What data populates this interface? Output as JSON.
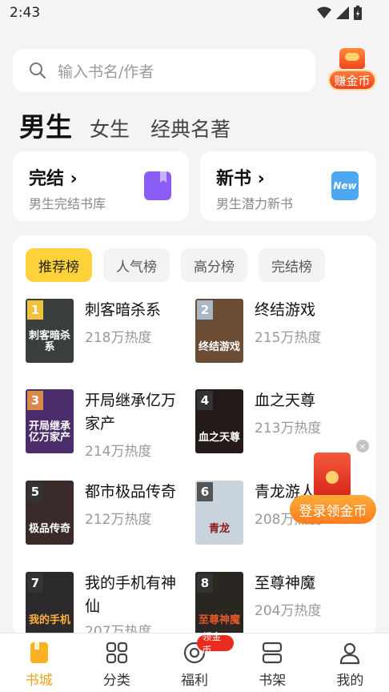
{
  "status": {
    "time": "2:43"
  },
  "search": {
    "placeholder": "输入书名/作者"
  },
  "coin_button": {
    "label": "赚金币"
  },
  "category_tabs": [
    "男生",
    "女生",
    "经典名著"
  ],
  "entries": [
    {
      "title": "完结",
      "subtitle": "男生完结书库",
      "icon": "bookmark-icon",
      "color": "#8b5cf6"
    },
    {
      "title": "新书",
      "subtitle": "男生潜力新书",
      "icon": "new-badge-icon",
      "icon_text": "New",
      "color": "#4da8f0"
    }
  ],
  "rank_tabs": [
    "推荐榜",
    "人气榜",
    "高分榜",
    "完结榜"
  ],
  "books": [
    {
      "rank": "1",
      "title": "刺客暗杀系",
      "heat": "218万热度",
      "cover_text": "刺客暗杀系",
      "cover_color": "#3a3f3c"
    },
    {
      "rank": "2",
      "title": "终结游戏",
      "heat": "215万热度",
      "cover_text": "终结游戏",
      "cover_color": "#6b4d36"
    },
    {
      "rank": "3",
      "title": "开局继承亿万家产",
      "heat": "214万热度",
      "cover_text": "开局继承亿万家产",
      "cover_color": "#4a2d6a"
    },
    {
      "rank": "4",
      "title": "血之天尊",
      "heat": "213万热度",
      "cover_text": "血之天尊",
      "cover_color": "#241a1a"
    },
    {
      "rank": "5",
      "title": "都市极品传奇",
      "heat": "212万热度",
      "cover_text": "极品传奇",
      "cover_color": "#3b2a2a"
    },
    {
      "rank": "6",
      "title": "青龙游人",
      "heat": "208万热度",
      "cover_text": "青龙",
      "cover_color": "#c9d3dc"
    },
    {
      "rank": "7",
      "title": "我的手机有神仙",
      "heat": "207万热度",
      "cover_text": "我的手机",
      "cover_color": "#2d2a2d"
    },
    {
      "rank": "8",
      "title": "至尊神魔",
      "heat": "204万热度",
      "cover_text": "至尊神魔",
      "cover_color": "#2a2622"
    }
  ],
  "floating_promo": {
    "label": "登录领金币"
  },
  "bottom_nav": [
    {
      "label": "书城",
      "icon": "bookstore-icon"
    },
    {
      "label": "分类",
      "icon": "grid-icon"
    },
    {
      "label": "福利",
      "icon": "coin-icon",
      "badge": "领金币"
    },
    {
      "label": "书架",
      "icon": "bookshelf-icon"
    },
    {
      "label": "我的",
      "icon": "user-icon"
    }
  ],
  "colors": {
    "accent": "#ffd23a",
    "brand_orange": "#f0a21a",
    "promo_red": "#ea2b1f"
  }
}
